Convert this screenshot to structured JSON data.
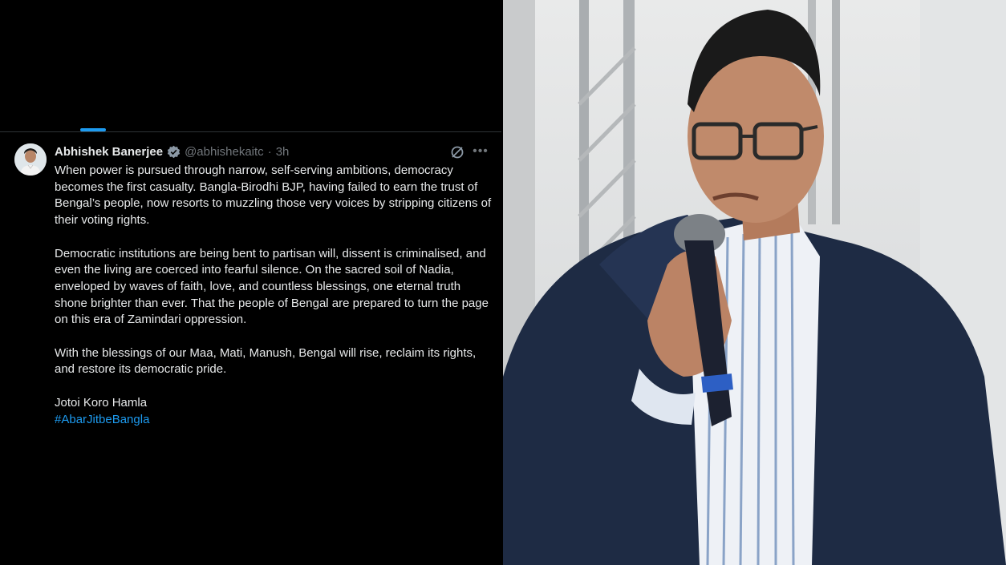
{
  "tweet": {
    "author_name": "Abhishek Banerjee",
    "handle": "@abhishekaitc",
    "separator": "·",
    "time": "3h",
    "paragraphs": [
      "When power is pursued through narrow, self-serving ambitions, democracy becomes the first casualty. Bangla-Birodhi BJP, having failed to earn the trust of Bengal’s people, now resorts to muzzling those very voices by stripping citizens of their voting rights.",
      "Democratic institutions are being bent to partisan will, dissent is criminalised, and even the living are coerced into fearful silence. On the sacred soil of Nadia, enveloped by waves of faith, love, and countless blessings, one eternal truth shone brighter than ever. That the people of Bengal are prepared to turn the page on this era of Zamindari oppression.",
      "With the blessings of our Maa, Mati, Manush, Bengal will rise, reclaim its rights, and restore its democratic pride."
    ],
    "closing_line": "Jotoi Koro Hamla",
    "hashtag": "#AbarJitbeBangla"
  },
  "icons": {
    "verified": "verified-badge-icon",
    "grok": "grok-icon",
    "more": "more-options-icon"
  },
  "colors": {
    "background": "#000000",
    "text_primary": "#e7e9ea",
    "text_secondary": "#71767b",
    "accent": "#1d9bf0",
    "border": "#2f3336"
  }
}
